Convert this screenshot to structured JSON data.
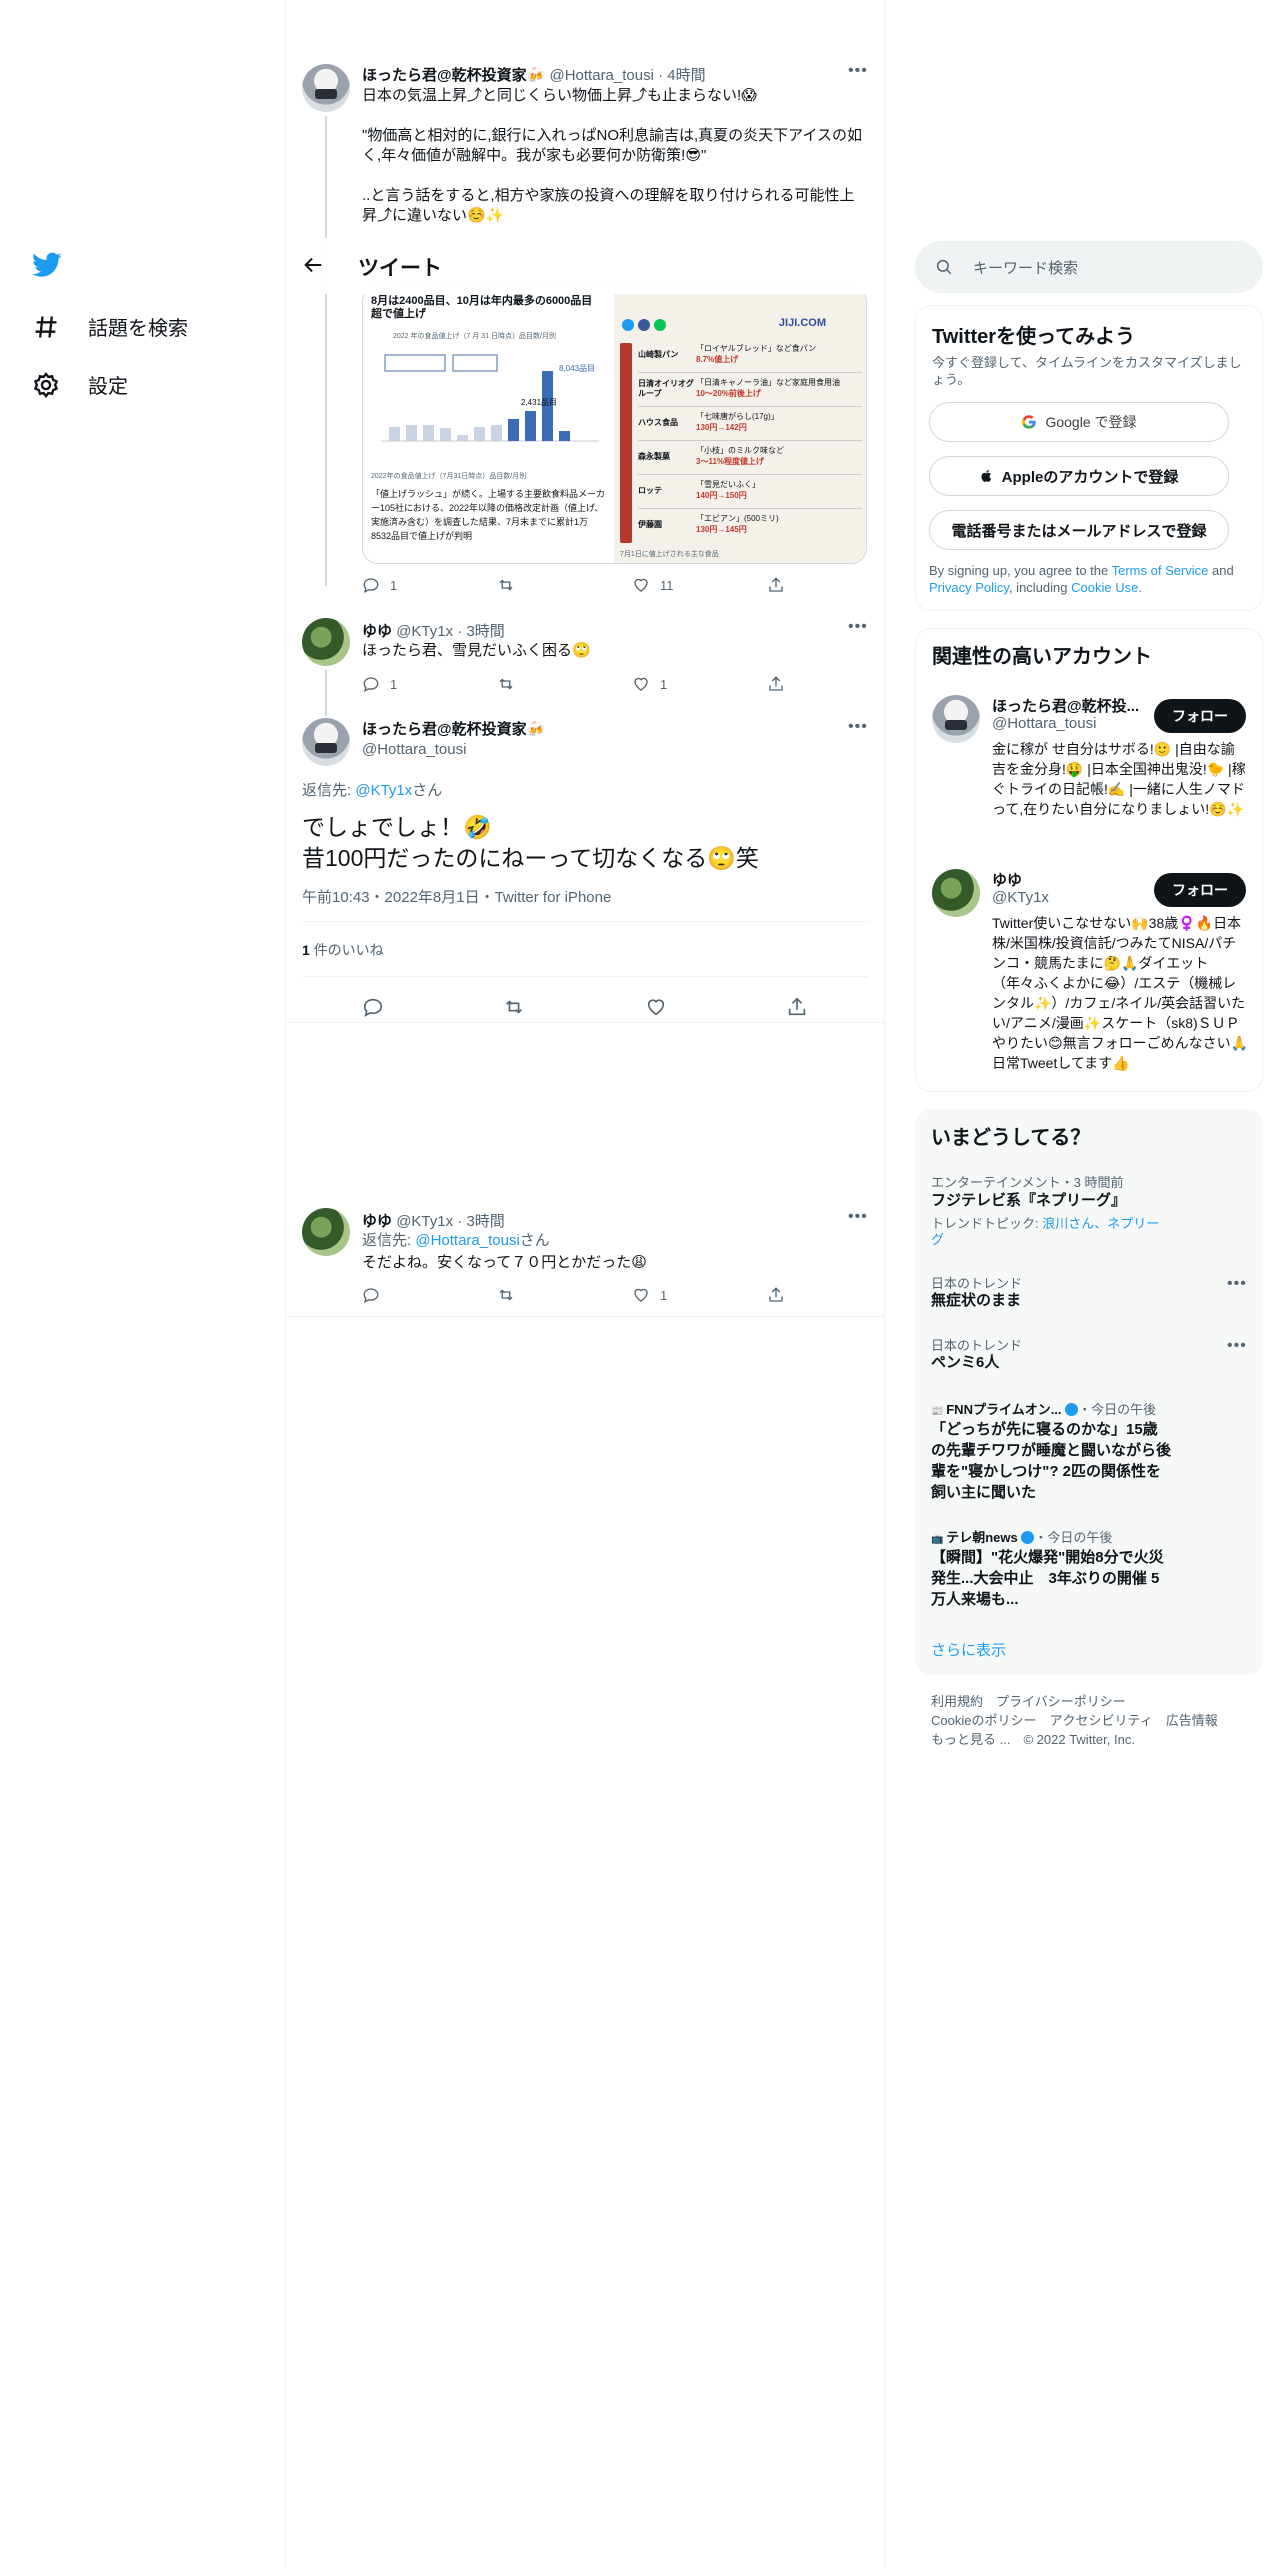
{
  "nav": {
    "logo": "twitter-bird",
    "items": [
      {
        "label": "話題を検索",
        "icon": "hashtag-icon"
      },
      {
        "label": "設定",
        "icon": "gear-icon"
      }
    ]
  },
  "header": {
    "title": "ツイート"
  },
  "tweets": {
    "t1": {
      "name": "ほったら君@乾杯投資家🍻",
      "handle": "@Hottara_tousi",
      "time": "4時間",
      "text1": "日本の気温上昇⤴︎と同じくらい物価上昇⤴︎も止まらない!😱",
      "text2": "\"物価高と相対的に,銀行に入れっぱNO利息諭吉は,真夏の炎天下アイスの如く,年々価値が融解中。我が家も必要何か防衛策!😎\"",
      "text3": "..と言う話をすると,相方や家族の投資への理解を取り付けられる可能性上昇⤴︎に違いない☺️✨",
      "replies": "1",
      "retweets": "",
      "likes": "11"
    },
    "images": {
      "left_title": "8月は2400品目、10月は年内最多の6000品目超で値上げ",
      "left_sub": "2022 年の食品値上げ（7 月 31 日時点）品目数/月別",
      "left_caption": "2022年の食品値上げ（7月31日時点）品目数/月別",
      "left_body": "「値上げラッシュ」が続く。上場する主要飲食料品メーカー105社における、2022年以降の価格改定計画（値上げ、実施済み含む）を調査した結果、7月末までに累計1万8532品目で値上げが判明",
      "bar_labels": [
        "2,431品目",
        "8,043品目"
      ],
      "right_brand": "JIJI.COM",
      "right_caption": "7月1日に値上げされる主な食品",
      "right_rows": [
        {
          "company": "山崎製パン",
          "product": "「ロイヤルブレッド」など食パン",
          "price": "8.7%値上げ"
        },
        {
          "company": "日清オイリオグループ",
          "product": "「日清キャノーラ油」など家庭用食用油",
          "price": "10～20%前後上げ"
        },
        {
          "company": "ハウス食品",
          "product": "「七味唐がらし(17g)」",
          "price": "130円→142円"
        },
        {
          "company": "森永製菓",
          "product": "「小枝」のミルク味など",
          "price": "3～11%程度値上げ"
        },
        {
          "company": "ロッテ",
          "product": "「雪見だいふく」",
          "price": "140円→150円"
        },
        {
          "company": "伊藤園",
          "product": "「エビアン」(500ミリ)",
          "price": "130円→145円"
        }
      ]
    },
    "t2": {
      "name": "ゆゆ",
      "handle": "@KTy1x",
      "time": "3時間",
      "text": "ほったら君、雪見だいふく困る🙄",
      "replies": "1",
      "likes": "1"
    },
    "main": {
      "name": "ほったら君@乾杯投資家🍻",
      "handle": "@Hottara_tousi",
      "reply_prefix": "返信先: ",
      "reply_to": "@KTy1x",
      "reply_suffix": "さん",
      "text1": "でしょでしょ！🤣",
      "text2": "昔100円だったのにねーって切なくなる🙄笑",
      "timestamp": "午前10:43・2022年8月1日・Twitter for iPhone",
      "likes_count": "1",
      "likes_label": " 件のいいね"
    },
    "t3": {
      "name": "ゆゆ",
      "handle": "@KTy1x",
      "time": "3時間",
      "reply_prefix": "返信先: ",
      "reply_to": "@Hottara_tousi",
      "reply_suffix": "さん",
      "text": "そだよね。安くなって７０円とかだった😩",
      "likes": "1"
    }
  },
  "search": {
    "placeholder": "キーワード検索"
  },
  "signup": {
    "title": "Twitterを使ってみよう",
    "subtitle": "今すぐ登録して、タイムラインをカスタマイズしましょう。",
    "google": "Google で登録",
    "apple": "Appleのアカウントで登録",
    "phone": "電話番号またはメールアドレスで登録",
    "terms_pre": "By signing up, you agree to the ",
    "terms_link": "Terms of Service",
    "terms_and": " and ",
    "privacy_link": "Privacy Policy",
    "terms_including": ", including ",
    "cookie_link": "Cookie Use",
    "terms_end": "."
  },
  "related": {
    "title": "関連性の高いアカウント",
    "accounts": [
      {
        "name": "ほったら君@乾杯投...",
        "handle": "@Hottara_tousi",
        "follow": "フォロー",
        "bio": "金に稼が せ自分はサボる!🙂 |自由な諭吉を金分身!🤑 |日本全国神出鬼没!🐤 |稼ぐトライの日記帳!✍️ |一緒に人生ノマドって,在りたい自分になりましょい!☺️✨"
      },
      {
        "name": "ゆゆ",
        "handle": "@KTy1x",
        "follow": "フォロー",
        "bio": "Twitter使いこなせない🙌38歳♀️🔥日本株/米国株/投資信託/つみたてNISA/パチンコ・競馬たまに🤔🙏ダイエット（年々ふくよかに😂）/エステ（機械レンタル✨）/カフェ/ネイル/英会話習いたい/アニメ/漫画✨スケート（sk8)ＳＵＰやりたい😊無言フォローごめんなさい🙏日常Tweetしてます👍"
      }
    ]
  },
  "trends": {
    "title": "いまどうしてる？",
    "items": [
      {
        "category": "エンターテインメント・3 時間前",
        "name": "フジテレビ系『ネプリーグ』",
        "topic": "トレンドトピック: 浪川さん、ネプリーグ"
      },
      {
        "category": "日本のトレンド",
        "name": "無症状のまま"
      },
      {
        "category": "日本のトレンド",
        "name": "ペンミ6人"
      }
    ],
    "news": [
      {
        "source": "FNNプライムオン...",
        "time": "・今日の午後",
        "headline": "「どっちが先に寝るのかな」15歳の先輩チワワが睡魔と闘いながら後輩を\"寝かしつけ\"? 2匹の関係性を飼い主に聞いた"
      },
      {
        "source": "テレ朝news",
        "time": "・今日の午後",
        "headline": "【瞬間】\"花火爆発\"開始8分で火災発生...大会中止　3年ぶりの開催 5万人来場も..."
      }
    ],
    "show_more": "さらに表示"
  },
  "footer": {
    "line1": [
      "利用規約",
      "プライバシーポリシー"
    ],
    "line2": [
      "Cookieのポリシー",
      "アクセシビリティ",
      "広告情報"
    ],
    "more": "もっと見る ...",
    "copyright": "© 2022 Twitter, Inc."
  },
  "colors": {
    "accent": "#1d9bf0",
    "text": "#0f1419",
    "muted": "#536471",
    "border": "#eff3f4"
  }
}
